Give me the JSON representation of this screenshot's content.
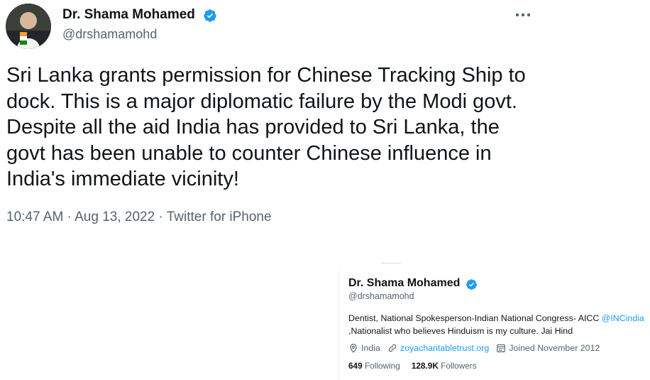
{
  "tweet": {
    "author_name": "Dr. Shama Mohamed",
    "author_handle": "@drshamamohd",
    "text": "Sri Lanka grants permission for Chinese Tracking Ship to dock. This is a major diplomatic failure by the Modi govt. Despite all the aid India has provided to Sri Lanka, the govt has been unable to counter Chinese influence in India's immediate vicinity!",
    "time": "10:47 AM",
    "date": "Aug 13, 2022",
    "source": "Twitter for iPhone",
    "separator": " · "
  },
  "profile_card": {
    "name": "Dr. Shama Mohamed",
    "handle": "@drshamamohd",
    "bio_before": "Dentist, National Spokesperson-Indian National Congress- AICC ",
    "bio_mention": "@INCindia",
    "bio_after": " ,Nationalist who believes Hinduism is my culture. Jai Hind",
    "location": "India",
    "website": "zoyacharitabletrust.org",
    "joined": "Joined November 2012",
    "following_count": "649",
    "following_label": "Following",
    "followers_count": "128.9K",
    "followers_label": "Followers"
  },
  "icons": {
    "verified": "verified-badge-icon",
    "more": "more-horizontal-icon",
    "location": "location-pin-icon",
    "link": "link-icon",
    "calendar": "calendar-icon"
  },
  "colors": {
    "accent": "#1d9bf0",
    "text": "#0f1419",
    "secondary": "#536471"
  }
}
